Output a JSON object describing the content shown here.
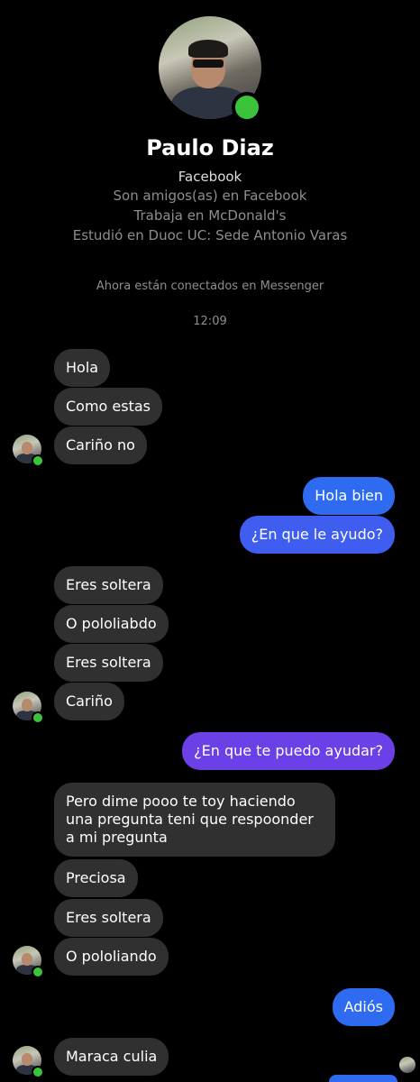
{
  "contact": {
    "name": "Paulo Diaz",
    "source": "Facebook",
    "info": [
      "Son amigos(as) en Facebook",
      "Trabaja en McDonald's",
      "Estudió en Duoc UC: Sede Antonio Varas"
    ],
    "avatar_icon": "profile-photo",
    "online_color": "#3bc43b"
  },
  "system": {
    "connected": "Ahora están conectados en Messenger",
    "time": "12:09"
  },
  "colors": {
    "incoming_bubble": "#303030",
    "outgoing_blue": "#2f6bf0",
    "outgoing_purple": "#6b40e6",
    "background": "#000000"
  },
  "messages": [
    {
      "dir": "in",
      "text": "Hola"
    },
    {
      "dir": "in",
      "text": "Como estas"
    },
    {
      "dir": "in",
      "text": "Cariño no"
    },
    {
      "dir": "out",
      "text": "Hola bien"
    },
    {
      "dir": "out",
      "text": "¿En que le ayudo?"
    },
    {
      "dir": "in",
      "text": "Eres soltera"
    },
    {
      "dir": "in",
      "text": "O pololiabdo"
    },
    {
      "dir": "in",
      "text": "Eres soltera"
    },
    {
      "dir": "in",
      "text": "Cariño"
    },
    {
      "dir": "out",
      "text": "¿En que te puedo ayudar?"
    },
    {
      "dir": "in",
      "text": "Pero dime pooo te toy haciendo una pregunta teni que respoonder a mi pregunta"
    },
    {
      "dir": "in",
      "text": "Preciosa"
    },
    {
      "dir": "in",
      "text": "Eres soltera"
    },
    {
      "dir": "in",
      "text": "O pololiando"
    },
    {
      "dir": "out",
      "text": "Adiós"
    },
    {
      "dir": "in",
      "text": "Maraca culia"
    }
  ]
}
